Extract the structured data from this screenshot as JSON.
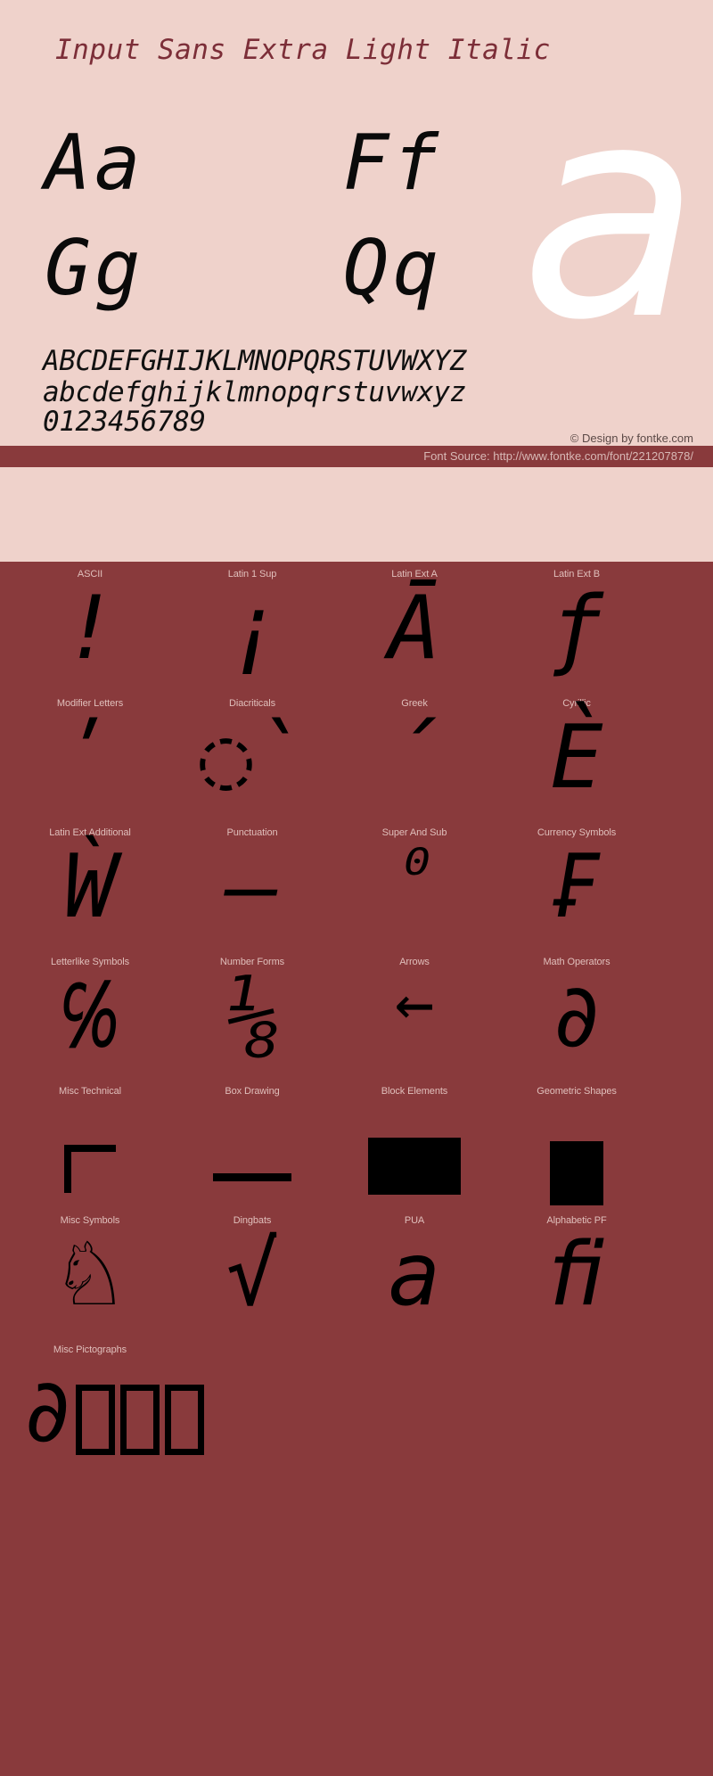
{
  "specimen": {
    "title": "Input Sans Extra Light Italic",
    "big_letter": "a",
    "pairs": [
      "Aa    Ff",
      "Gg    Qq"
    ],
    "alphabet_upper": "ABCDEFGHIJKLMNOPQRSTUVWXYZ",
    "alphabet_lower": "abcdefghijklmnopqrstuvwxyz",
    "digits": "0123456789",
    "copyright": "© Design by fontke.com",
    "font_source": "Font Source: http://www.fontke.com/font/221207878/"
  },
  "colors": {
    "specimen_background": "#efd2cb",
    "title_color": "#7c2e38",
    "grid_background": "#893a3c",
    "label_color": "#e0bfbb",
    "glyph_color": "#000000",
    "big_letter_color": "#ffffff",
    "source_text_color": "#d8b9b6"
  },
  "glyph_grid": {
    "rows": [
      [
        {
          "label": "ASCII",
          "glyph": "!"
        },
        {
          "label": "Latin 1 Sup",
          "glyph": "¡"
        },
        {
          "label": "Latin Ext A",
          "glyph": "Ā"
        },
        {
          "label": "Latin Ext B",
          "glyph": "ƒ"
        }
      ],
      [
        {
          "label": "Modifier Letters",
          "glyph": "ʹ"
        },
        {
          "label": "Diacriticals",
          "glyph": "◌̀"
        },
        {
          "label": "Greek",
          "glyph": "΄"
        },
        {
          "label": "Cyrillic",
          "glyph": "Ѐ"
        }
      ],
      [
        {
          "label": "Latin Ext Additional",
          "glyph": "Ẁ"
        },
        {
          "label": "Punctuation",
          "glyph": "—"
        },
        {
          "label": "Super And Sub",
          "glyph": "⁰"
        },
        {
          "label": "Currency Symbols",
          "glyph": "₣"
        }
      ],
      [
        {
          "label": "Letterlike Symbols",
          "glyph": "℅"
        },
        {
          "label": "Number Forms",
          "glyph": "⅛"
        },
        {
          "label": "Arrows",
          "glyph": "←"
        },
        {
          "label": "Math Operators",
          "glyph": "∂"
        }
      ],
      [
        {
          "label": "Misc Technical",
          "glyph": "⌐"
        },
        {
          "label": "Box Drawing",
          "glyph": "─"
        },
        {
          "label": "Block Elements",
          "glyph": "█"
        },
        {
          "label": "Geometric Shapes",
          "glyph": "■"
        }
      ],
      [
        {
          "label": "Misc Symbols",
          "glyph": "♘"
        },
        {
          "label": "Dingbats",
          "glyph": "√"
        },
        {
          "label": "PUA",
          "glyph": "a"
        },
        {
          "label": "Alphabetic PF",
          "glyph": "ﬁ"
        }
      ],
      [
        {
          "label": "Misc Pictographs",
          "glyph": "∂"
        }
      ]
    ]
  }
}
